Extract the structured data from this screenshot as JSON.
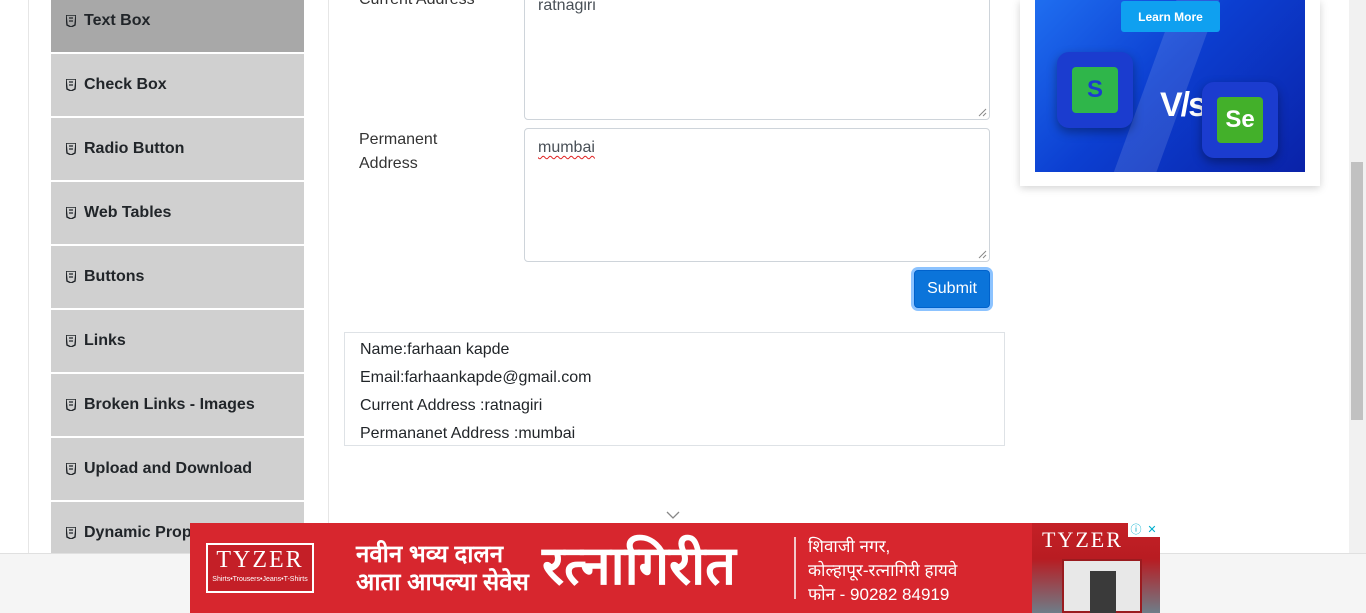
{
  "sidebar": {
    "items": [
      {
        "label": "Text Box",
        "icon": "html5-icon",
        "active": true
      },
      {
        "label": "Check Box",
        "icon": "html5-icon"
      },
      {
        "label": "Radio Button",
        "icon": "html5-icon"
      },
      {
        "label": "Web Tables",
        "icon": "html5-icon"
      },
      {
        "label": "Buttons",
        "icon": "html5-icon"
      },
      {
        "label": "Links",
        "icon": "html5-icon"
      },
      {
        "label": "Broken Links - Images",
        "icon": "html5-icon"
      },
      {
        "label": "Upload and Download",
        "icon": "html5-icon"
      },
      {
        "label": "Dynamic Properties",
        "icon": "html5-icon"
      }
    ]
  },
  "form": {
    "current_address_label": "Current Address",
    "current_address_value": "ratnagiri",
    "permanent_address_label_line1": "Permanent",
    "permanent_address_label_line2": "Address",
    "permanent_address_value": "mumbai",
    "submit_label": "Submit"
  },
  "output": {
    "name": "Name:farhaan kapde",
    "email": "Email:farhaankapde@gmail.com",
    "current_address": "Current Address :ratnagiri",
    "permanent_address": "Permananet Address :mumbai"
  },
  "ad_top": {
    "button": "Learn More",
    "vs": "V/s",
    "left_logo": "S",
    "right_logo": "Se"
  },
  "ad_bottom": {
    "brand": "TYZER",
    "brand_sub": "Shirts•Trousers•Jeans•T-Shirts",
    "line1": "नवीन भव्य दालन",
    "line2": "आता आपल्या सेवेस",
    "headline": "रत्नागिरीत",
    "addr1": "शिवाजी नगर,",
    "addr2": "कोल्हापूर-रत्नागिरी हायवे",
    "phone": "फोन - 90282 84919"
  },
  "colors": {
    "submit": "#0b74da",
    "sidebar_item": "#d0d0d0",
    "sidebar_active": "#a8a8a8",
    "banner_red": "#d7262e"
  }
}
